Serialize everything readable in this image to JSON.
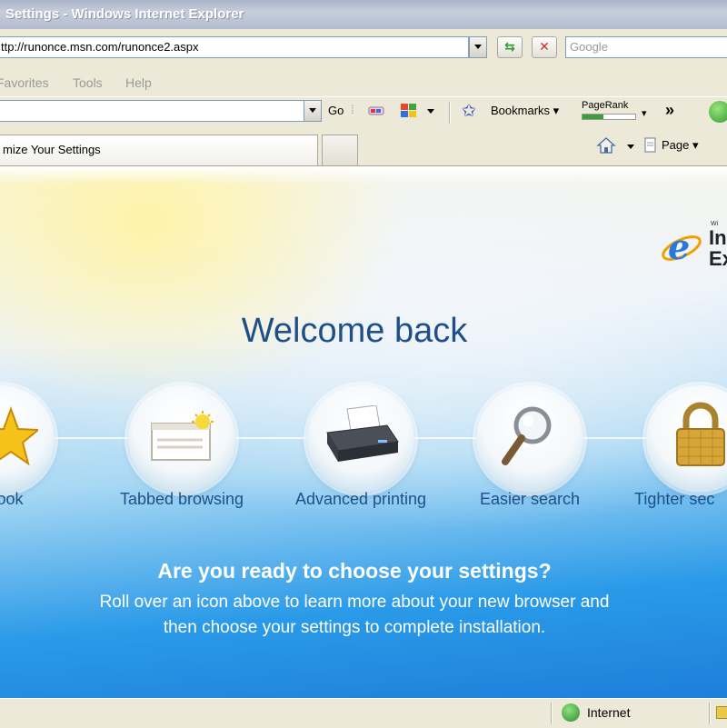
{
  "window": {
    "title": "Settings - Windows Internet Explorer"
  },
  "address": {
    "url": "ttp://runonce.msn.com/runonce2.aspx"
  },
  "search": {
    "placeholder": "Google"
  },
  "menu": {
    "items": [
      "Favorites",
      "Tools",
      "Help"
    ]
  },
  "google_toolbar": {
    "go_label": "Go",
    "bookmarks_label": "Bookmarks",
    "pagerank_label": "PageRank",
    "more_label": "»"
  },
  "tabs": {
    "active_label": "mize Your Settings"
  },
  "command_bar": {
    "page_label": "Page"
  },
  "logo": {
    "line1": "In",
    "line2": "Ex",
    "small": "Wi"
  },
  "content": {
    "heading": "Welcome back",
    "features": [
      {
        "label": "w look",
        "icon": "star-icon"
      },
      {
        "label": "Tabbed browsing",
        "icon": "tabs-icon"
      },
      {
        "label": "Advanced printing",
        "icon": "printer-icon"
      },
      {
        "label": "Easier search",
        "icon": "magnifier-icon"
      },
      {
        "label": "Tighter sec",
        "icon": "padlock-icon"
      }
    ],
    "question": "Are you ready to choose your settings?",
    "instruction_line1": "Roll over an icon above to learn more about your new browser and",
    "instruction_line2": "then choose your settings to complete installation."
  },
  "status": {
    "zone": "Internet"
  },
  "colors": {
    "heading": "#1f4f88",
    "chrome": "#ece9d8",
    "accent_blue": "#1d7fd9"
  }
}
